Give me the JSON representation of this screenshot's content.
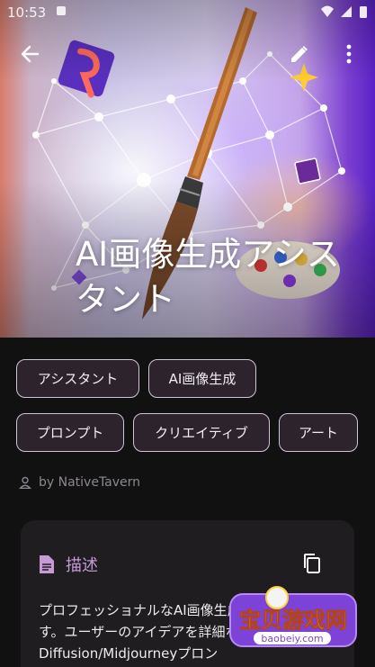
{
  "status_bar": {
    "time": "10:53"
  },
  "hero": {
    "title_line1": "AI画像生成アシス",
    "title_line2": "タント",
    "back_icon": "arrow-back-icon",
    "edit_icon": "pencil-icon",
    "more_icon": "more-vert-icon"
  },
  "tags": {
    "row1": [
      "アシスタント",
      "AI画像生成"
    ],
    "row2": [
      "プロンプト",
      "クリエイティブ",
      "アート"
    ]
  },
  "author": {
    "text": "by NativeTavern",
    "icon": "person-icon"
  },
  "description": {
    "title": "描述",
    "icon": "document-icon",
    "copy_icon": "copy-icon",
    "body": "プロフェッショナルなAI画像生成アシスタントです。ユーザーのアイデアを詳細なStable Diffusion/Midjourneyプロン"
  },
  "watermark": {
    "text": "宝贝游戏网",
    "url": "baobeiy.com"
  },
  "colors": {
    "background": "#111111",
    "accent": "#c69ad6",
    "tag_bg": "#2c232d",
    "card_bg": "#1f1d20"
  }
}
